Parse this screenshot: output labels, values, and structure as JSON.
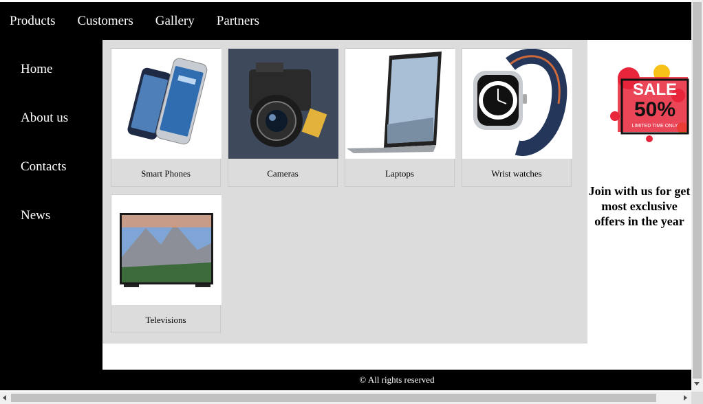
{
  "topnav": {
    "items": [
      "Products",
      "Customers",
      "Gallery",
      "Partners"
    ]
  },
  "sidebar": {
    "items": [
      "Home",
      "About us",
      "Contacts",
      "News"
    ]
  },
  "products": [
    {
      "label": "Smart Phones",
      "icon": "smartphone-image"
    },
    {
      "label": "Cameras",
      "icon": "camera-image"
    },
    {
      "label": "Laptops",
      "icon": "laptop-image"
    },
    {
      "label": "Wrist watches",
      "icon": "smartwatch-image"
    },
    {
      "label": "Televisions",
      "icon": "television-image"
    }
  ],
  "aside": {
    "sale_word": "SALE",
    "sale_percent": "50%",
    "sale_note": "LIMITED TIME ONLY",
    "promo_text": "Join with us for get most exclusive offers in the year"
  },
  "footer": {
    "text": "© All rights reserved"
  },
  "colors": {
    "nav_bg": "#000000",
    "content_bg": "#dcdcdc",
    "sale_red": "#e8253b",
    "sale_yellow": "#f6c21a"
  }
}
